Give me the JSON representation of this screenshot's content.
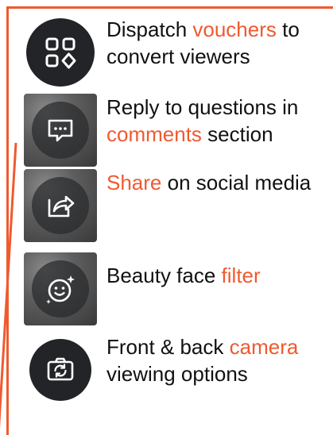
{
  "items": [
    {
      "icon": "voucher-grid-icon",
      "parts": [
        {
          "text": "Dispatch "
        },
        {
          "text": "vouchers",
          "highlight": true
        },
        {
          "text": " to convert viewers"
        }
      ]
    },
    {
      "icon": "comment-bubble-icon",
      "parts": [
        {
          "text": "Reply to questions in "
        },
        {
          "text": "comments",
          "highlight": true
        },
        {
          "text": " section"
        }
      ]
    },
    {
      "icon": "share-icon",
      "parts": [
        {
          "text": "Share",
          "highlight": true
        },
        {
          "text": " on social media"
        }
      ]
    },
    {
      "icon": "beauty-face-icon",
      "parts": [
        {
          "text": "Beauty face "
        },
        {
          "text": "filter",
          "highlight": true
        }
      ]
    },
    {
      "icon": "camera-flip-icon",
      "parts": [
        {
          "text": "Front & back "
        },
        {
          "text": "camera",
          "highlight": true
        },
        {
          "text": " viewing options"
        }
      ]
    }
  ],
  "colors": {
    "accent": "#ef5a2f",
    "text": "#111111",
    "icon_bg": "#222427"
  }
}
